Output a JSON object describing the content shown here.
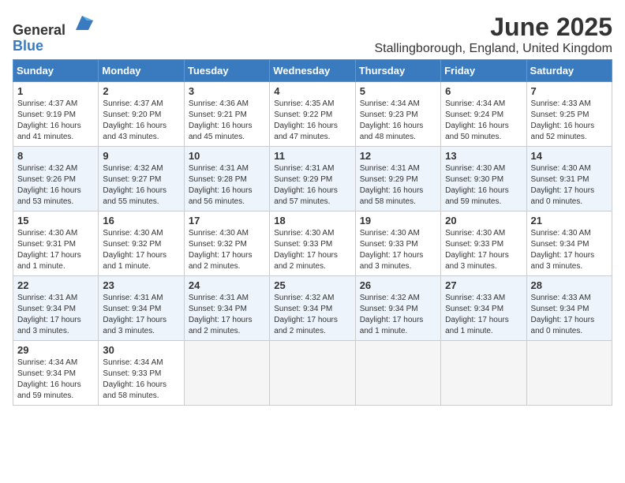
{
  "logo": {
    "text_general": "General",
    "text_blue": "Blue"
  },
  "title": "June 2025",
  "location": "Stallingborough, England, United Kingdom",
  "days_of_week": [
    "Sunday",
    "Monday",
    "Tuesday",
    "Wednesday",
    "Thursday",
    "Friday",
    "Saturday"
  ],
  "weeks": [
    [
      {
        "day": "1",
        "info": "Sunrise: 4:37 AM\nSunset: 9:19 PM\nDaylight: 16 hours\nand 41 minutes."
      },
      {
        "day": "2",
        "info": "Sunrise: 4:37 AM\nSunset: 9:20 PM\nDaylight: 16 hours\nand 43 minutes."
      },
      {
        "day": "3",
        "info": "Sunrise: 4:36 AM\nSunset: 9:21 PM\nDaylight: 16 hours\nand 45 minutes."
      },
      {
        "day": "4",
        "info": "Sunrise: 4:35 AM\nSunset: 9:22 PM\nDaylight: 16 hours\nand 47 minutes."
      },
      {
        "day": "5",
        "info": "Sunrise: 4:34 AM\nSunset: 9:23 PM\nDaylight: 16 hours\nand 48 minutes."
      },
      {
        "day": "6",
        "info": "Sunrise: 4:34 AM\nSunset: 9:24 PM\nDaylight: 16 hours\nand 50 minutes."
      },
      {
        "day": "7",
        "info": "Sunrise: 4:33 AM\nSunset: 9:25 PM\nDaylight: 16 hours\nand 52 minutes."
      }
    ],
    [
      {
        "day": "8",
        "info": "Sunrise: 4:32 AM\nSunset: 9:26 PM\nDaylight: 16 hours\nand 53 minutes."
      },
      {
        "day": "9",
        "info": "Sunrise: 4:32 AM\nSunset: 9:27 PM\nDaylight: 16 hours\nand 55 minutes."
      },
      {
        "day": "10",
        "info": "Sunrise: 4:31 AM\nSunset: 9:28 PM\nDaylight: 16 hours\nand 56 minutes."
      },
      {
        "day": "11",
        "info": "Sunrise: 4:31 AM\nSunset: 9:29 PM\nDaylight: 16 hours\nand 57 minutes."
      },
      {
        "day": "12",
        "info": "Sunrise: 4:31 AM\nSunset: 9:29 PM\nDaylight: 16 hours\nand 58 minutes."
      },
      {
        "day": "13",
        "info": "Sunrise: 4:30 AM\nSunset: 9:30 PM\nDaylight: 16 hours\nand 59 minutes."
      },
      {
        "day": "14",
        "info": "Sunrise: 4:30 AM\nSunset: 9:31 PM\nDaylight: 17 hours\nand 0 minutes."
      }
    ],
    [
      {
        "day": "15",
        "info": "Sunrise: 4:30 AM\nSunset: 9:31 PM\nDaylight: 17 hours\nand 1 minute."
      },
      {
        "day": "16",
        "info": "Sunrise: 4:30 AM\nSunset: 9:32 PM\nDaylight: 17 hours\nand 1 minute."
      },
      {
        "day": "17",
        "info": "Sunrise: 4:30 AM\nSunset: 9:32 PM\nDaylight: 17 hours\nand 2 minutes."
      },
      {
        "day": "18",
        "info": "Sunrise: 4:30 AM\nSunset: 9:33 PM\nDaylight: 17 hours\nand 2 minutes."
      },
      {
        "day": "19",
        "info": "Sunrise: 4:30 AM\nSunset: 9:33 PM\nDaylight: 17 hours\nand 3 minutes."
      },
      {
        "day": "20",
        "info": "Sunrise: 4:30 AM\nSunset: 9:33 PM\nDaylight: 17 hours\nand 3 minutes."
      },
      {
        "day": "21",
        "info": "Sunrise: 4:30 AM\nSunset: 9:34 PM\nDaylight: 17 hours\nand 3 minutes."
      }
    ],
    [
      {
        "day": "22",
        "info": "Sunrise: 4:31 AM\nSunset: 9:34 PM\nDaylight: 17 hours\nand 3 minutes."
      },
      {
        "day": "23",
        "info": "Sunrise: 4:31 AM\nSunset: 9:34 PM\nDaylight: 17 hours\nand 3 minutes."
      },
      {
        "day": "24",
        "info": "Sunrise: 4:31 AM\nSunset: 9:34 PM\nDaylight: 17 hours\nand 2 minutes."
      },
      {
        "day": "25",
        "info": "Sunrise: 4:32 AM\nSunset: 9:34 PM\nDaylight: 17 hours\nand 2 minutes."
      },
      {
        "day": "26",
        "info": "Sunrise: 4:32 AM\nSunset: 9:34 PM\nDaylight: 17 hours\nand 1 minute."
      },
      {
        "day": "27",
        "info": "Sunrise: 4:33 AM\nSunset: 9:34 PM\nDaylight: 17 hours\nand 1 minute."
      },
      {
        "day": "28",
        "info": "Sunrise: 4:33 AM\nSunset: 9:34 PM\nDaylight: 17 hours\nand 0 minutes."
      }
    ],
    [
      {
        "day": "29",
        "info": "Sunrise: 4:34 AM\nSunset: 9:34 PM\nDaylight: 16 hours\nand 59 minutes."
      },
      {
        "day": "30",
        "info": "Sunrise: 4:34 AM\nSunset: 9:33 PM\nDaylight: 16 hours\nand 58 minutes."
      },
      {
        "day": "",
        "info": ""
      },
      {
        "day": "",
        "info": ""
      },
      {
        "day": "",
        "info": ""
      },
      {
        "day": "",
        "info": ""
      },
      {
        "day": "",
        "info": ""
      }
    ]
  ]
}
